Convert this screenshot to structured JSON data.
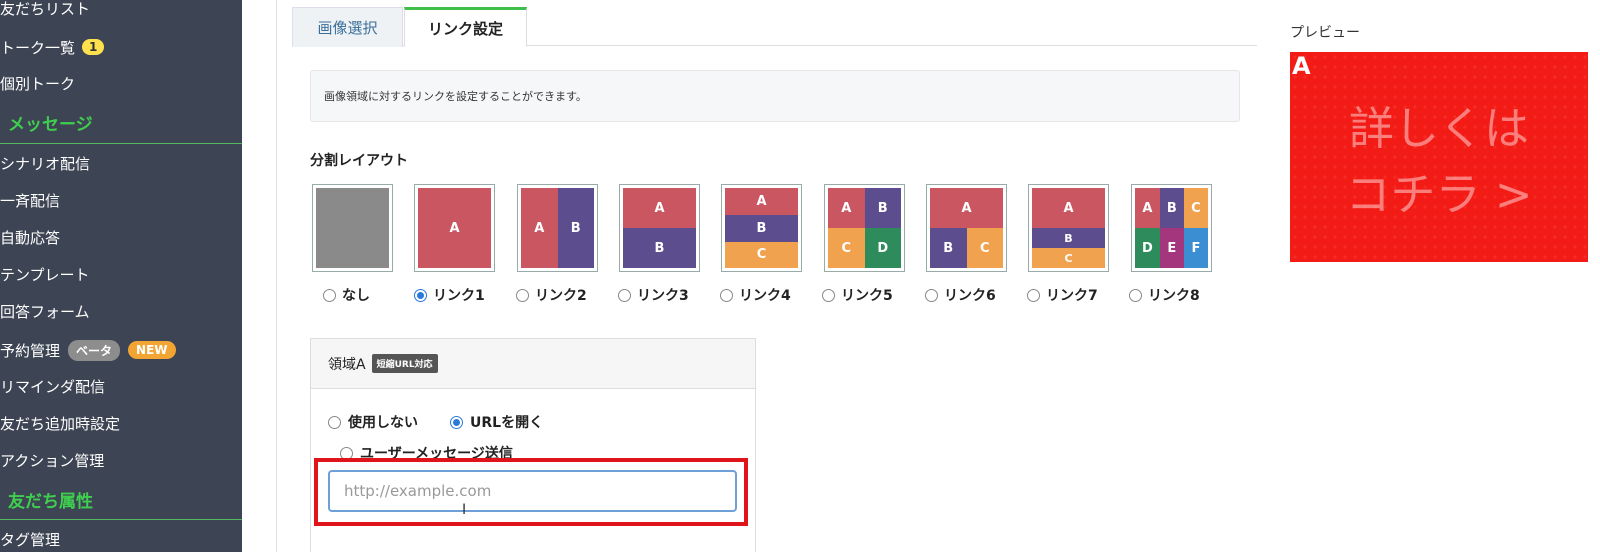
{
  "sidebar": {
    "items": [
      {
        "label": "友だちリスト"
      },
      {
        "label": "トーク一覧",
        "badge": "1"
      },
      {
        "label": "個別トーク"
      },
      {
        "label": "シナリオ配信"
      },
      {
        "label": "一斉配信"
      },
      {
        "label": "自動応答"
      },
      {
        "label": "テンプレート"
      },
      {
        "label": "回答フォーム"
      },
      {
        "label": "予約管理",
        "badge_beta": "ベータ",
        "badge_new": "NEW"
      },
      {
        "label": "リマインダ配信"
      },
      {
        "label": "友だち追加時設定"
      },
      {
        "label": "アクション管理"
      },
      {
        "label": "タグ管理"
      }
    ],
    "sections": [
      {
        "label": "メッセージ"
      },
      {
        "label": "友だち属性"
      }
    ]
  },
  "tabs": [
    {
      "label": "画像選択"
    },
    {
      "label": "リンク設定"
    }
  ],
  "info_text": "画像領域に対するリンクを設定することができます。",
  "layout_title": "分割レイアウト",
  "layout_options": [
    {
      "label": "なし"
    },
    {
      "label": "リンク1",
      "checked": true
    },
    {
      "label": "リンク2"
    },
    {
      "label": "リンク3"
    },
    {
      "label": "リンク4"
    },
    {
      "label": "リンク5"
    },
    {
      "label": "リンク6"
    },
    {
      "label": "リンク7"
    },
    {
      "label": "リンク8"
    }
  ],
  "region_letters": {
    "a": "A",
    "b": "B",
    "c": "C",
    "d": "D",
    "e": "E",
    "f": "F"
  },
  "colors": {
    "red": "#c95660",
    "purple": "#5b4d8e",
    "orange": "#f1a24f",
    "green": "#2e8b5c",
    "magenta": "#a3367d",
    "blue": "#3b8ed1",
    "gray": "#8a8a8a",
    "accent_green": "#3fcf4f",
    "highlight_red": "#e0151c"
  },
  "panel": {
    "title": "領域A",
    "badge": "短縮URL対応",
    "options": [
      {
        "label": "使用しない",
        "checked": false
      },
      {
        "label": "URLを開く",
        "checked": true
      },
      {
        "label": "ユーザーメッセージ送信",
        "checked": false
      }
    ],
    "url_placeholder": "http://example.com"
  },
  "preview": {
    "label": "プレビュー",
    "region_letter": "A",
    "image_text": "詳しくは\nコチラ >"
  }
}
